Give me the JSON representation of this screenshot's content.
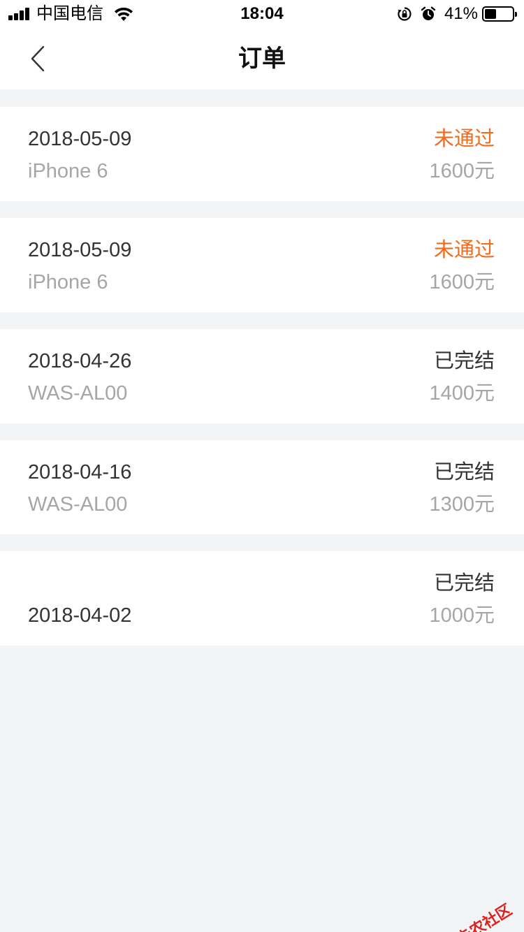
{
  "status_bar": {
    "carrier": "中国电信",
    "time": "18:04",
    "battery_percent": "41%",
    "battery_level": 0.41,
    "icons": [
      "signal-icon",
      "wifi-icon",
      "orientation-lock-icon",
      "alarm-icon",
      "battery-icon"
    ]
  },
  "nav": {
    "title": "订单",
    "back_icon": "chevron-left-icon"
  },
  "colors": {
    "rejected": "#f26a1b",
    "primary_text": "#333333",
    "secondary_text": "#a6a6a6",
    "background": "#f3f4f6",
    "card": "#ffffff"
  },
  "orders": [
    {
      "date": "2018-05-09",
      "model": "iPhone 6",
      "status": "未通过",
      "amount": "1600元"
    },
    {
      "date": "2018-05-09",
      "model": "iPhone 6",
      "status": "未通过",
      "amount": "1600元"
    },
    {
      "date": "2018-04-26",
      "model": "WAS-AL00",
      "status": "已完结",
      "amount": "1400元"
    },
    {
      "date": "2018-04-16",
      "model": "WAS-AL00",
      "status": "已完结",
      "amount": "1300元"
    },
    {
      "date": "2018-04-02",
      "model": "",
      "status": "已完结",
      "amount": "1000元"
    }
  ],
  "watermark": {
    "text": "卡农社区"
  }
}
